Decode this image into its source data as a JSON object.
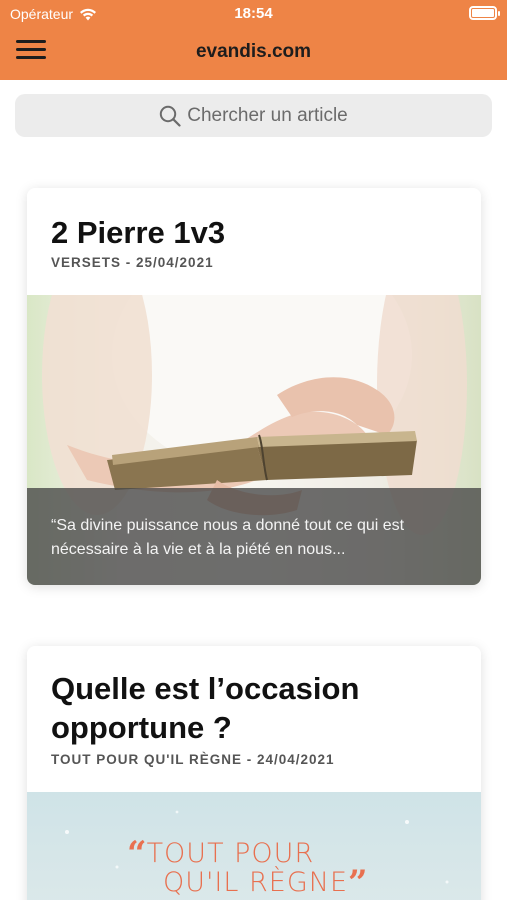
{
  "status_bar": {
    "carrier": "Opérateur",
    "time": "18:54"
  },
  "nav": {
    "title": "evandis.com"
  },
  "search": {
    "placeholder": "Chercher un article"
  },
  "colors": {
    "accent": "#ee8446",
    "search_bg": "#ececec"
  },
  "articles": [
    {
      "title": "2 Pierre 1v3",
      "meta": "VERSETS - 25/04/2021",
      "excerpt": "“Sa divine puissance nous a donné tout ce qui est nécessaire à la vie et à la piété en nous..."
    },
    {
      "title_line1": "Quelle est l’occasion",
      "title_line2": "opportune ?",
      "meta": "TOUT POUR QU'IL RÈGNE - 24/04/2021",
      "image_logo": {
        "line1": "TOUT POUR",
        "line2": "QU'IL RÈGNE"
      }
    }
  ]
}
